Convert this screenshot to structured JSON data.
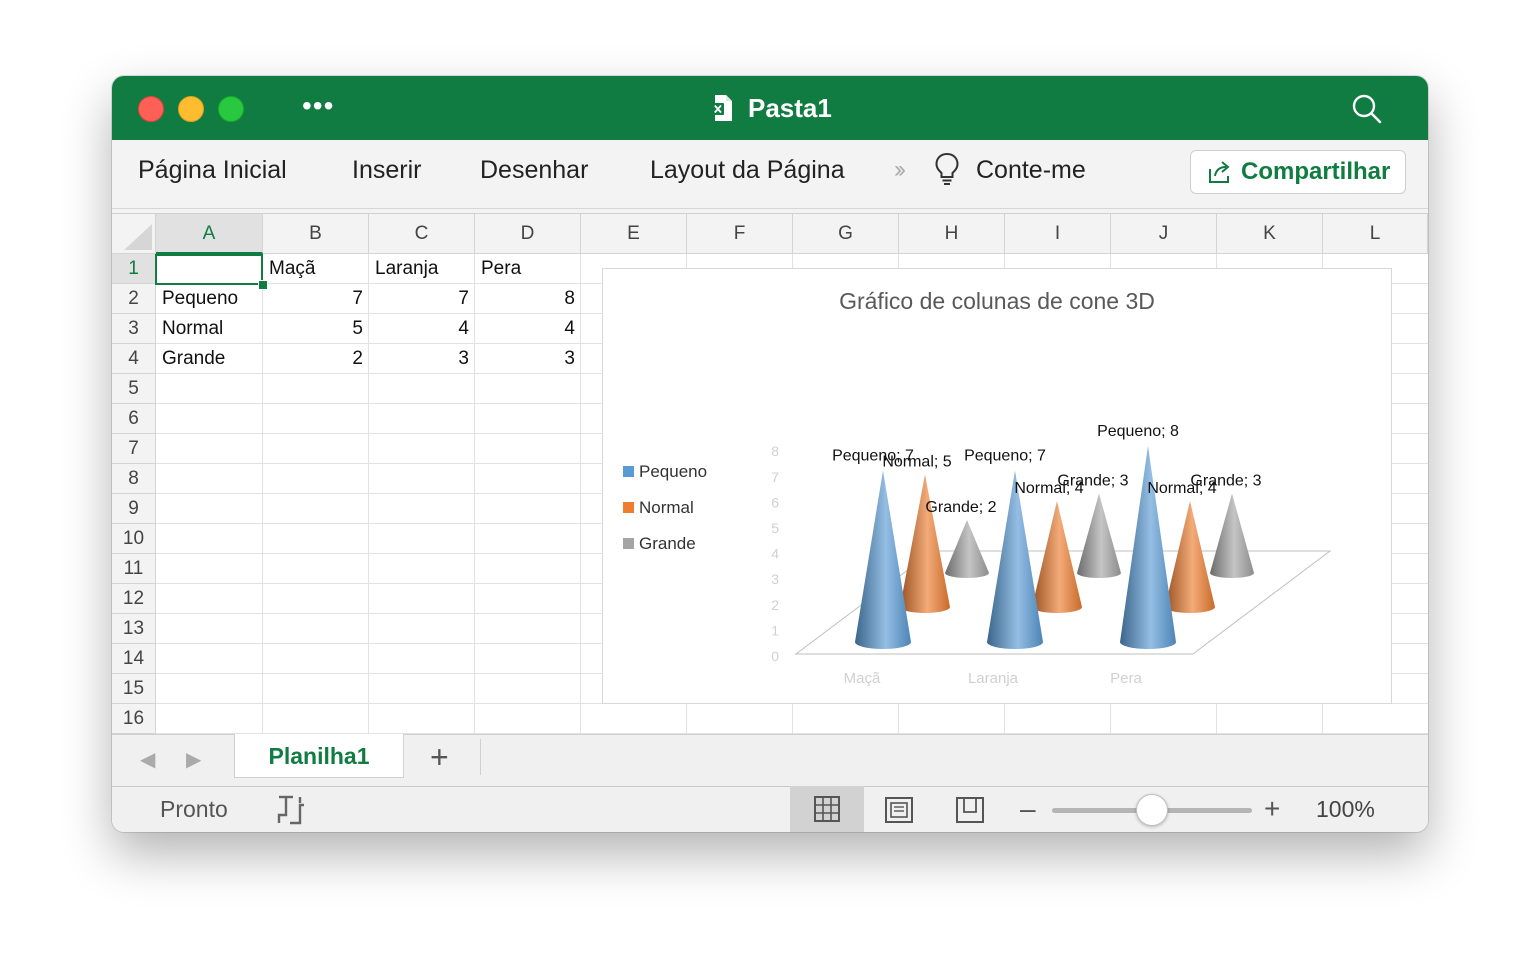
{
  "window": {
    "title": "Pasta1",
    "more_label": "•••"
  },
  "ribbon": {
    "tabs": [
      "Página Inicial",
      "Inserir",
      "Desenhar",
      "Layout da Página"
    ],
    "overflow": "»",
    "tell_me": "Conte-me",
    "share_label": "Compartilhar"
  },
  "columns": [
    "A",
    "B",
    "C",
    "D",
    "E",
    "F",
    "G",
    "H",
    "I",
    "J",
    "K",
    "L"
  ],
  "rows": [
    "1",
    "2",
    "3",
    "4",
    "5",
    "6",
    "7",
    "8",
    "9",
    "10",
    "11",
    "12",
    "13",
    "14",
    "15",
    "16"
  ],
  "cells": {
    "B1": "Maçã",
    "C1": "Laranja",
    "D1": "Pera",
    "A2": "Pequeno",
    "B2": "7",
    "C2": "7",
    "D2": "8",
    "A3": "Normal",
    "B3": "5",
    "C3": "4",
    "D3": "4",
    "A4": "Grande",
    "B4": "2",
    "C4": "3",
    "D4": "3"
  },
  "chart_data": {
    "type": "bar",
    "subtype": "3d-cone",
    "title": "Gráfico de colunas de cone 3D",
    "categories": [
      "Maçã",
      "Laranja",
      "Pera"
    ],
    "series": [
      {
        "name": "Pequeno",
        "values": [
          7,
          7,
          8
        ],
        "color": "#5b9bd5"
      },
      {
        "name": "Normal",
        "values": [
          5,
          4,
          4
        ],
        "color": "#ed7d31"
      },
      {
        "name": "Grande",
        "values": [
          2,
          3,
          3
        ],
        "color": "#a5a5a5"
      }
    ],
    "yticks": [
      "0",
      "1",
      "2",
      "3",
      "4",
      "5",
      "6",
      "7",
      "8"
    ],
    "ylim": [
      0,
      8
    ],
    "legend_position": "left",
    "data_label_sep": "; "
  },
  "sheets": {
    "active": "Planilha1",
    "add_label": "+"
  },
  "status": {
    "ready": "Pronto",
    "zoom": "100%",
    "zoom_minus": "–",
    "zoom_plus": "+"
  },
  "colors": {
    "excel_green": "#107c41"
  }
}
